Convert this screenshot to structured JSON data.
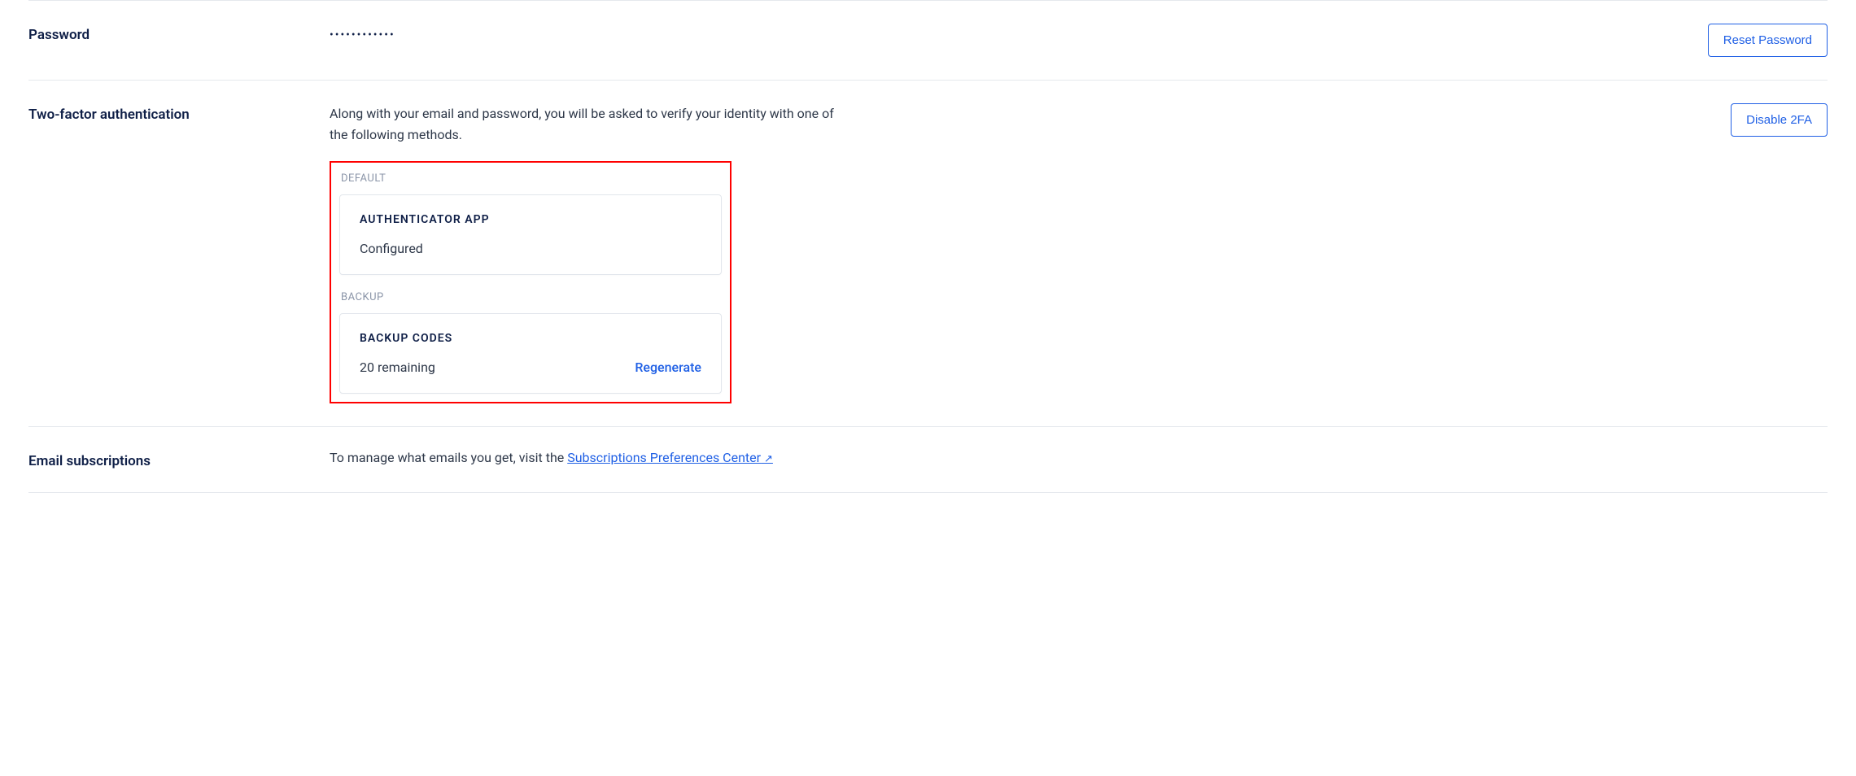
{
  "password_section": {
    "label": "Password",
    "masked_value": "••••••••••••",
    "action_label": "Reset Password"
  },
  "twofa_section": {
    "label": "Two-factor authentication",
    "description": "Along with your email and password, you will be asked to verify your identity with one of the following methods.",
    "action_label": "Disable 2FA",
    "default_group_label": "DEFAULT",
    "authenticator_card": {
      "title": "AUTHENTICATOR APP",
      "status": "Configured"
    },
    "backup_group_label": "BACKUP",
    "backup_card": {
      "title": "BACKUP CODES",
      "status": "20 remaining",
      "action": "Regenerate"
    }
  },
  "email_section": {
    "label": "Email subscriptions",
    "intro_text": "To manage what emails you get, visit the ",
    "link_text": "Subscriptions Preferences Center",
    "link_icon": "↗"
  }
}
